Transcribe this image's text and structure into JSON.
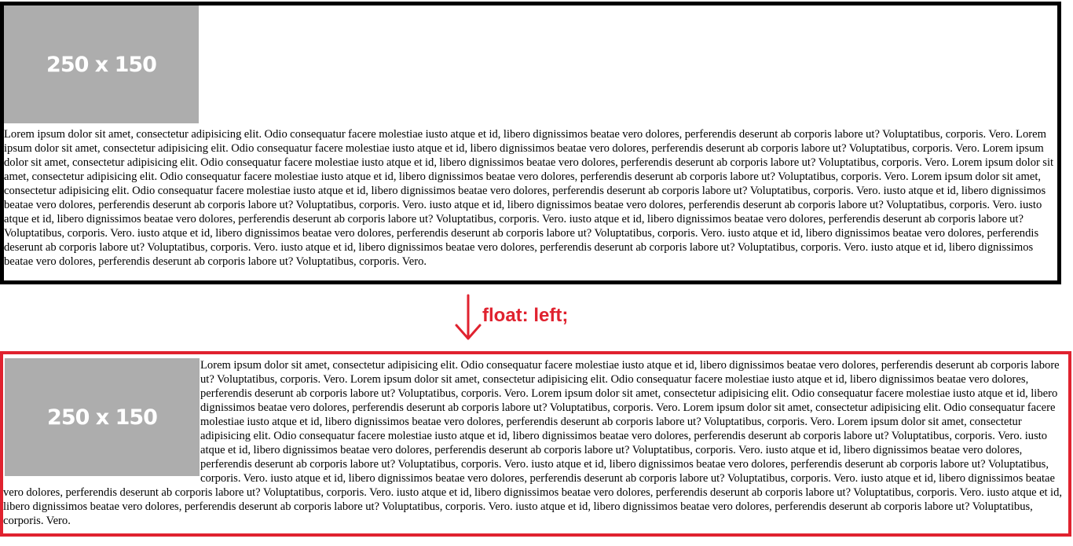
{
  "before": {
    "image_label": "250 x 150",
    "paragraph": "Lorem ipsum dolor sit amet, consectetur adipisicing elit. Odio consequatur facere molestiae iusto atque et id, libero dignissimos beatae vero dolores, perferendis deserunt ab corporis labore ut? Voluptatibus, corporis. Vero. Lorem ipsum dolor sit amet, consectetur adipisicing elit. Odio consequatur facere molestiae iusto atque et id, libero dignissimos beatae vero dolores, perferendis deserunt ab corporis labore ut? Voluptatibus, corporis. Vero. Lorem ipsum dolor sit amet, consectetur adipisicing elit. Odio consequatur facere molestiae iusto atque et id, libero dignissimos beatae vero dolores, perferendis deserunt ab corporis labore ut? Voluptatibus, corporis. Vero. Lorem ipsum dolor sit amet, consectetur adipisicing elit. Odio consequatur facere molestiae iusto atque et id, libero dignissimos beatae vero dolores, perferendis deserunt ab corporis labore ut? Voluptatibus, corporis. Vero. Lorem ipsum dolor sit amet, consectetur adipisicing elit. Odio consequatur facere molestiae iusto atque et id, libero dignissimos beatae vero dolores, perferendis deserunt ab corporis labore ut? Voluptatibus, corporis. Vero. iusto atque et id, libero dignissimos beatae vero dolores, perferendis deserunt ab corporis labore ut? Voluptatibus, corporis. Vero. iusto atque et id, libero dignissimos beatae vero dolores, perferendis deserunt ab corporis labore ut? Voluptatibus, corporis. Vero. iusto atque et id, libero dignissimos beatae vero dolores, perferendis deserunt ab corporis labore ut? Voluptatibus, corporis. Vero. iusto atque et id, libero dignissimos beatae vero dolores, perferendis deserunt ab corporis labore ut? Voluptatibus, corporis. Vero. iusto atque et id, libero dignissimos beatae vero dolores, perferendis deserunt ab corporis labore ut? Voluptatibus, corporis. Vero. iusto atque et id, libero dignissimos beatae vero dolores, perferendis deserunt ab corporis labore ut? Voluptatibus, corporis. Vero. iusto atque et id, libero dignissimos beatae vero dolores, perferendis deserunt ab corporis labore ut? Voluptatibus, corporis. Vero. iusto atque et id, libero dignissimos beatae vero dolores, perferendis deserunt ab corporis labore ut? Voluptatibus, corporis. Vero."
  },
  "annotation": {
    "label": "float: left;",
    "color": "#e0222f"
  },
  "after": {
    "image_label": "250 x 150",
    "paragraph": "Lorem ipsum dolor sit amet, consectetur adipisicing elit. Odio consequatur facere molestiae iusto atque et id, libero dignissimos beatae vero dolores, perferendis deserunt ab corporis labore ut? Voluptatibus, corporis. Vero. Lorem ipsum dolor sit amet, consectetur adipisicing elit. Odio consequatur facere molestiae iusto atque et id, libero dignissimos beatae vero dolores, perferendis deserunt ab corporis labore ut? Voluptatibus, corporis. Vero. Lorem ipsum dolor sit amet, consectetur adipisicing elit. Odio consequatur facere molestiae iusto atque et id, libero dignissimos beatae vero dolores, perferendis deserunt ab corporis labore ut? Voluptatibus, corporis. Vero. Lorem ipsum dolor sit amet, consectetur adipisicing elit. Odio consequatur facere molestiae iusto atque et id, libero dignissimos beatae vero dolores, perferendis deserunt ab corporis labore ut? Voluptatibus, corporis. Vero. Lorem ipsum dolor sit amet, consectetur adipisicing elit. Odio consequatur facere molestiae iusto atque et id, libero dignissimos beatae vero dolores, perferendis deserunt ab corporis labore ut? Voluptatibus, corporis. Vero. iusto atque et id, libero dignissimos beatae vero dolores, perferendis deserunt ab corporis labore ut? Voluptatibus, corporis. Vero. iusto atque et id, libero dignissimos beatae vero dolores, perferendis deserunt ab corporis labore ut? Voluptatibus, corporis. Vero. iusto atque et id, libero dignissimos beatae vero dolores, perferendis deserunt ab corporis labore ut? Voluptatibus, corporis. Vero. iusto atque et id, libero dignissimos beatae vero dolores, perferendis deserunt ab corporis labore ut? Voluptatibus, corporis. Vero. iusto atque et id, libero dignissimos beatae vero dolores, perferendis deserunt ab corporis labore ut? Voluptatibus, corporis. Vero. iusto atque et id, libero dignissimos beatae vero dolores, perferendis deserunt ab corporis labore ut? Voluptatibus, corporis. Vero. iusto atque et id, libero dignissimos beatae vero dolores, perferendis deserunt ab corporis labore ut? Voluptatibus, corporis. Vero. iusto atque et id, libero dignissimos beatae vero dolores, perferendis deserunt ab corporis labore ut? Voluptatibus, corporis. Vero."
  }
}
